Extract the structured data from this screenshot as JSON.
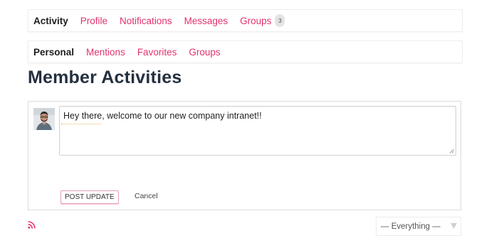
{
  "primary_nav": {
    "items": [
      {
        "label": "Activity",
        "active": true
      },
      {
        "label": "Profile"
      },
      {
        "label": "Notifications"
      },
      {
        "label": "Messages"
      },
      {
        "label": "Groups",
        "count": "3"
      }
    ]
  },
  "secondary_nav": {
    "items": [
      {
        "label": "Personal",
        "active": true
      },
      {
        "label": "Mentions"
      },
      {
        "label": "Favorites"
      },
      {
        "label": "Groups"
      }
    ]
  },
  "page_title": "Member Activities",
  "post_form": {
    "text": "Hey there, welcome to our new company intranet!!",
    "post_label": "POST UPDATE",
    "cancel_label": "Cancel"
  },
  "filter": {
    "selected": "— Everything —"
  },
  "icons": {
    "rss": "rss-icon",
    "avatar": "user-avatar",
    "dropdown": "triangle-down-icon"
  },
  "colors": {
    "accent": "#e2336b",
    "title": "#24303f"
  }
}
